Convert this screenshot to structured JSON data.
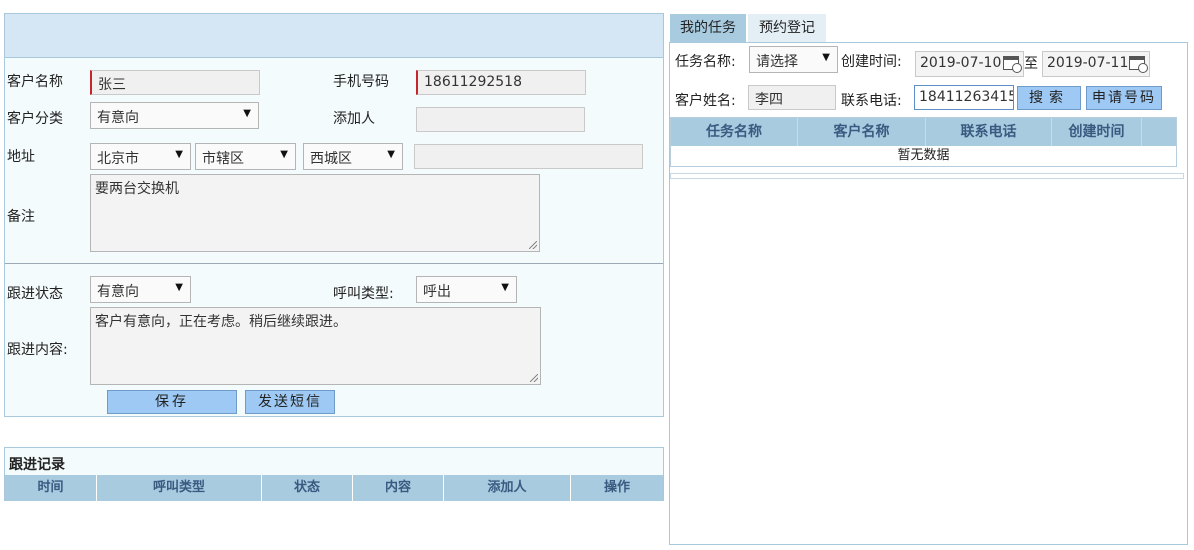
{
  "form": {
    "customer_name_label": "客户名称",
    "customer_name_value": "张三",
    "phone_label": "手机号码",
    "phone_value": "18611292518",
    "category_label": "客户分类",
    "category_value": "有意向",
    "added_by_label": "添加人",
    "added_by_value": "",
    "address_label": "地址",
    "province_value": "北京市",
    "city_value": "市辖区",
    "district_value": "西城区",
    "address_detail_value": "",
    "remark_label": "备注",
    "remark_value": "要两台交换机",
    "follow_status_label": "跟进状态",
    "follow_status_value": "有意向",
    "call_type_label": "呼叫类型:",
    "call_type_value": "呼出",
    "follow_content_label": "跟进内容:",
    "follow_content_value": "客户有意向，正在考虑。稍后继续跟进。",
    "save_button": "保存",
    "send_sms_button": "发送短信"
  },
  "records": {
    "title": "跟进记录",
    "columns": [
      "时间",
      "呼叫类型",
      "状态",
      "内容",
      "添加人",
      "操作"
    ]
  },
  "tabs": [
    "我的任务",
    "预约登记"
  ],
  "search": {
    "task_name_label": "任务名称:",
    "task_name_value": "请选择",
    "created_time_label": "创建时间:",
    "date_from": "2019-07-10",
    "date_to_label": "至",
    "date_to": "2019-07-11",
    "customer_label": "客户姓名:",
    "customer_value": "李四",
    "contact_phone_label": "联系电话:",
    "contact_phone_value": "18411263415",
    "search_button": "搜索",
    "apply_number_button": "申请号码"
  },
  "task_table": {
    "columns": [
      "任务名称",
      "客户名称",
      "联系电话",
      "创建时间"
    ],
    "empty_text": "暂无数据"
  },
  "colors": {
    "header_bg": "#d5e6f5",
    "table_header_bg": "#a8cbe0",
    "button_bg": "#9ec9f4",
    "active_tab_bg": "#a8cbe0",
    "required_marker": "#c4262b"
  }
}
